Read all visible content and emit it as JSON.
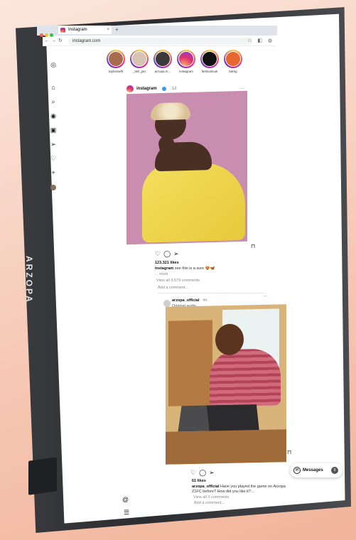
{
  "device": {
    "brand": "ARZOPA"
  },
  "browser": {
    "tab_title": "Instagram",
    "tab_close": "×",
    "new_tab": "+",
    "back": "←",
    "forward": "→",
    "reload": "↻",
    "url": "instagram.com",
    "window_dot_colors": [
      "#ff5f57",
      "#febc2e",
      "#28c840"
    ]
  },
  "sidebar": {
    "items": [
      {
        "icon": "instagram-icon",
        "glyph": "◎"
      },
      {
        "icon": "home-icon",
        "glyph": "⌂"
      },
      {
        "icon": "search-icon",
        "glyph": "⌕"
      },
      {
        "icon": "explore-icon",
        "glyph": "◉"
      },
      {
        "icon": "reels-icon",
        "glyph": "▣"
      },
      {
        "icon": "direct-icon",
        "glyph": "➢"
      },
      {
        "icon": "heart-icon",
        "glyph": "♡"
      },
      {
        "icon": "create-icon",
        "glyph": "+"
      }
    ],
    "threads_glyph": "@",
    "menu_glyph": "☰"
  },
  "stories": [
    {
      "name": "taylorswift"
    },
    {
      "name": "_itsh_jan"
    },
    {
      "name": "arzopa.m..."
    },
    {
      "name": "instagram"
    },
    {
      "name": "fashionlook"
    },
    {
      "name": "bdmg"
    }
  ],
  "post1": {
    "username": "instagram",
    "time": "· 1d",
    "more": "···",
    "likes": "123,321 likes",
    "caption_user": "instagram",
    "caption_text": "see this is a sure 😍🦋",
    "more_link": "... more",
    "view_comments": "View all 3,579 comments",
    "add_comment": "Add a comment..."
  },
  "post2": {
    "username": "arzopa_official",
    "time": "· 4h",
    "audio": "Original audio",
    "more": "···",
    "likes": "61 likes",
    "caption_user": "arzopa_official",
    "caption_text": "Have you played the game on Arzopa Z1FC before? How did you like it?...",
    "view_comments": "View all 3 comments",
    "add_comment": "Add a comment..."
  },
  "messages": {
    "label": "Messages",
    "badge": "9"
  }
}
